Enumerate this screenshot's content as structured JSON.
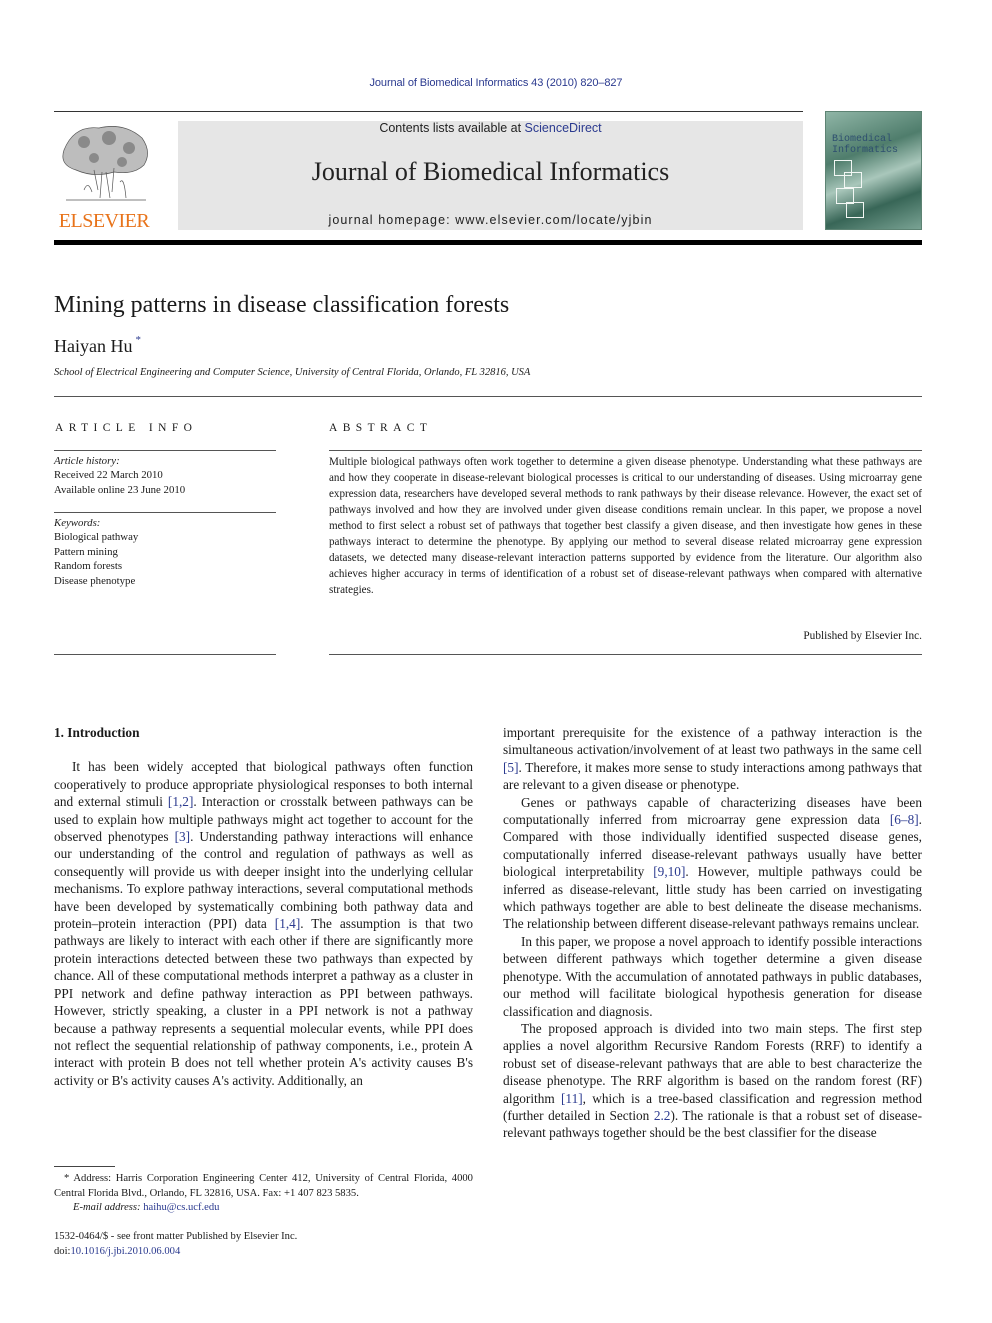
{
  "header": {
    "citation": "Journal of Biomedical Informatics 43 (2010) 820–827",
    "contents_prefix": "Contents lists available at ",
    "contents_link": "ScienceDirect",
    "journal_name": "Journal of Biomedical Informatics",
    "homepage": "journal homepage: www.elsevier.com/locate/yjbin",
    "publisher_logo_text": "ELSEVIER",
    "cover": {
      "title_line1": "Biomedical",
      "title_line2": "Informatics"
    },
    "colors": {
      "link": "#2b3a8f",
      "elsevier_orange": "#e8731a",
      "banner_gray": "#e6e6e6"
    }
  },
  "article": {
    "title": "Mining patterns in disease classification forests",
    "author": "Haiyan Hu",
    "author_marker": "*",
    "affiliation": "School of Electrical Engineering and Computer Science, University of Central Florida, Orlando, FL 32816, USA"
  },
  "article_info": {
    "heading": "ARTICLE INFO",
    "history_label": "Article history:",
    "received": "Received 22 March 2010",
    "available": "Available online 23 June 2010",
    "keywords_label": "Keywords:",
    "keywords": [
      "Biological pathway",
      "Pattern mining",
      "Random forests",
      "Disease phenotype"
    ]
  },
  "abstract": {
    "heading": "ABSTRACT",
    "text": "Multiple biological pathways often work together to determine a given disease phenotype. Understanding what these pathways are and how they cooperate in disease-relevant biological processes is critical to our understanding of diseases. Using microarray gene expression data, researchers have developed several methods to rank pathways by their disease relevance. However, the exact set of pathways involved and how they are involved under given disease conditions remain unclear. In this paper, we propose a novel method to first select a robust set of pathways that together best classify a given disease, and then investigate how genes in these pathways interact to determine the phenotype. By applying our method to several disease related microarray gene expression datasets, we detected many disease-relevant interaction patterns supported by evidence from the literature. Our algorithm also achieves higher accuracy in terms of identification of a robust set of disease-relevant pathways when compared with alternative strategies.",
    "publisher": "Published by Elsevier Inc."
  },
  "body": {
    "section_heading": "1. Introduction",
    "left": {
      "p1": [
        {
          "t": "It has been widely accepted that biological pathways often function cooperatively to produce appropriate physiological responses to both internal and external stimuli "
        },
        {
          "ref": "[1,2]"
        },
        {
          "t": ". Interaction or crosstalk between pathways can be used to explain how multiple pathways might act together to account for the observed phenotypes "
        },
        {
          "ref": "[3]"
        },
        {
          "t": ". Understanding pathway interactions will enhance our understanding of the control and regulation of pathways as well as consequently will provide us with deeper insight into the underlying cellular mechanisms. To explore pathway interactions, several computational methods have been developed by systematically combining both pathway data and protein–protein interaction (PPI) data "
        },
        {
          "ref": "[1,4]"
        },
        {
          "t": ". The assumption is that two pathways are likely to interact with each other if there are significantly more protein interactions detected between these two pathways than expected by chance. All of these computational methods interpret a pathway as a cluster in PPI network and define pathway interaction as PPI between pathways. However, strictly speaking, a cluster in a PPI network is not a pathway because a pathway represents a sequential molecular events, while PPI does not reflect the sequential relationship of pathway components, i.e., protein A interact with protein B does not tell whether protein A's activity causes B's activity or B's activity causes A's activity. Additionally, an"
        }
      ]
    },
    "right": {
      "p0": [
        {
          "t": "important prerequisite for the existence of a pathway interaction is the simultaneous activation/involvement of at least two pathways in the same cell "
        },
        {
          "ref": "[5]"
        },
        {
          "t": ". Therefore, it makes more sense to study interactions among pathways that are relevant to a given disease or phenotype."
        }
      ],
      "p1": [
        {
          "t": "Genes or pathways capable of characterizing diseases have been computationally inferred from microarray gene expression data "
        },
        {
          "ref": "[6–8]"
        },
        {
          "t": ". Compared with those individually identified suspected disease genes, computationally inferred disease-relevant pathways usually have better biological interpretability "
        },
        {
          "ref": "[9,10]"
        },
        {
          "t": ". However, multiple pathways could be inferred as disease-relevant, little study has been carried on investigating which pathways together are able to best delineate the disease mechanisms. The relationship between different disease-relevant pathways remains unclear."
        }
      ],
      "p2": [
        {
          "t": "In this paper, we propose a novel approach to identify possible interactions between different pathways which together determine a given disease phenotype. With the accumulation of annotated pathways in public databases, our method will facilitate biological hypothesis generation for disease classification and diagnosis."
        }
      ],
      "p3": [
        {
          "t": "The proposed approach is divided into two main steps. The first step applies a novel algorithm Recursive Random Forests (RRF) to identify a robust set of disease-relevant pathways that are able to best characterize the disease phenotype. The RRF algorithm is based on the random forest (RF) algorithm "
        },
        {
          "ref": "[11]"
        },
        {
          "t": ", which is a tree-based classification and regression method (further detailed in Section "
        },
        {
          "ref": "2.2"
        },
        {
          "t": "). The rationale is that a robust set of disease-relevant pathways together should be the best classifier for the disease"
        }
      ]
    }
  },
  "footnote": {
    "marker": "*",
    "address": "Address: Harris Corporation Engineering Center 412, University of Central Florida, 4000 Central Florida Blvd., Orlando, FL 32816, USA. Fax: +1 407 823 5835.",
    "email_label": "E-mail address:",
    "email": "haihu@cs.ucf.edu"
  },
  "front_matter": {
    "issn_line": "1532-0464/$ - see front matter Published by Elsevier Inc.",
    "doi_prefix": "doi:",
    "doi": "10.1016/j.jbi.2010.06.004"
  }
}
